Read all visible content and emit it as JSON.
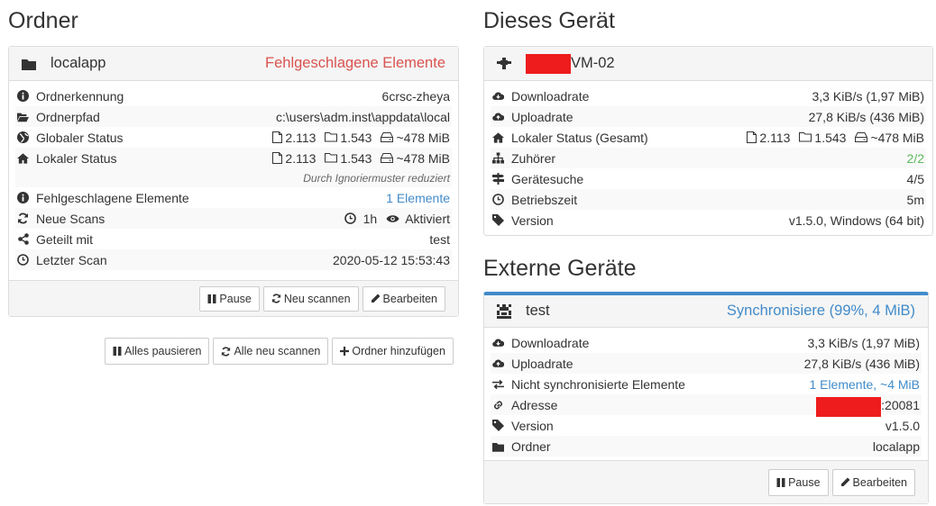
{
  "folders": {
    "heading": "Ordner",
    "folder": {
      "name": "localapp",
      "status": "Fehlgeschlagene Elemente",
      "rows": {
        "id_label": "Ordnerkennung",
        "id_value": "6crsc-zheya",
        "path_label": "Ordnerpfad",
        "path_value": "c:\\users\\adm.inst\\appdata\\local",
        "global_label": "Globaler Status",
        "global_files": "2.113",
        "global_dirs": "1.543",
        "global_size": "~478 MiB",
        "local_label": "Lokaler Status",
        "local_files": "2.113",
        "local_dirs": "1.543",
        "local_size": "~478 MiB",
        "ignore_note": "Durch Ignoriermuster reduziert",
        "failed_label": "Fehlgeschlagene Elemente",
        "failed_value": "1 Elemente",
        "rescan_label": "Neue Scans",
        "rescan_interval": "1h",
        "rescan_watch": "Aktiviert",
        "shared_label": "Geteilt mit",
        "shared_value": "test",
        "lastscan_label": "Letzter Scan",
        "lastscan_value": "2020-05-12 15:53:43"
      },
      "buttons": {
        "pause": "Pause",
        "rescan": "Neu scannen",
        "edit": "Bearbeiten"
      }
    },
    "global_buttons": {
      "pause_all": "Alles pausieren",
      "rescan_all": "Alle neu scannen",
      "add_folder": "Ordner hinzufügen"
    }
  },
  "this_device": {
    "heading": "Dieses Gerät",
    "name_suffix": "VM-02",
    "rows": {
      "down_label": "Downloadrate",
      "down_value": "3,3 KiB/s (1,97 MiB)",
      "up_label": "Uploadrate",
      "up_value": "27,8 KiB/s (436 MiB)",
      "local_label": "Lokaler Status (Gesamt)",
      "local_files": "2.113",
      "local_dirs": "1.543",
      "local_size": "~478 MiB",
      "listeners_label": "Zuhörer",
      "listeners_value": "2/2",
      "discovery_label": "Gerätesuche",
      "discovery_value": "4/5",
      "uptime_label": "Betriebszeit",
      "uptime_value": "5m",
      "version_label": "Version",
      "version_value": "v1.5.0, Windows (64 bit)"
    }
  },
  "remote": {
    "heading": "Externe Geräte",
    "device": {
      "name": "test",
      "status": "Synchronisiere (99%, 4 MiB)",
      "rows": {
        "down_label": "Downloadrate",
        "down_value": "3,3 KiB/s (1,97 MiB)",
        "up_label": "Uploadrate",
        "up_value": "27,8 KiB/s (436 MiB)",
        "oos_label": "Nicht synchronisierte Elemente",
        "oos_value": "1 Elemente, ~4 MiB",
        "addr_label": "Adresse",
        "addr_suffix": ":20081",
        "version_label": "Version",
        "version_value": "v1.5.0",
        "folders_label": "Ordner",
        "folders_value": "localapp"
      },
      "buttons": {
        "pause": "Pause",
        "edit": "Bearbeiten"
      }
    }
  },
  "colors": {
    "accent": "#428bca",
    "error": "#d9534f",
    "ok": "#5cb85c",
    "redaction": "#ee1c1c"
  }
}
